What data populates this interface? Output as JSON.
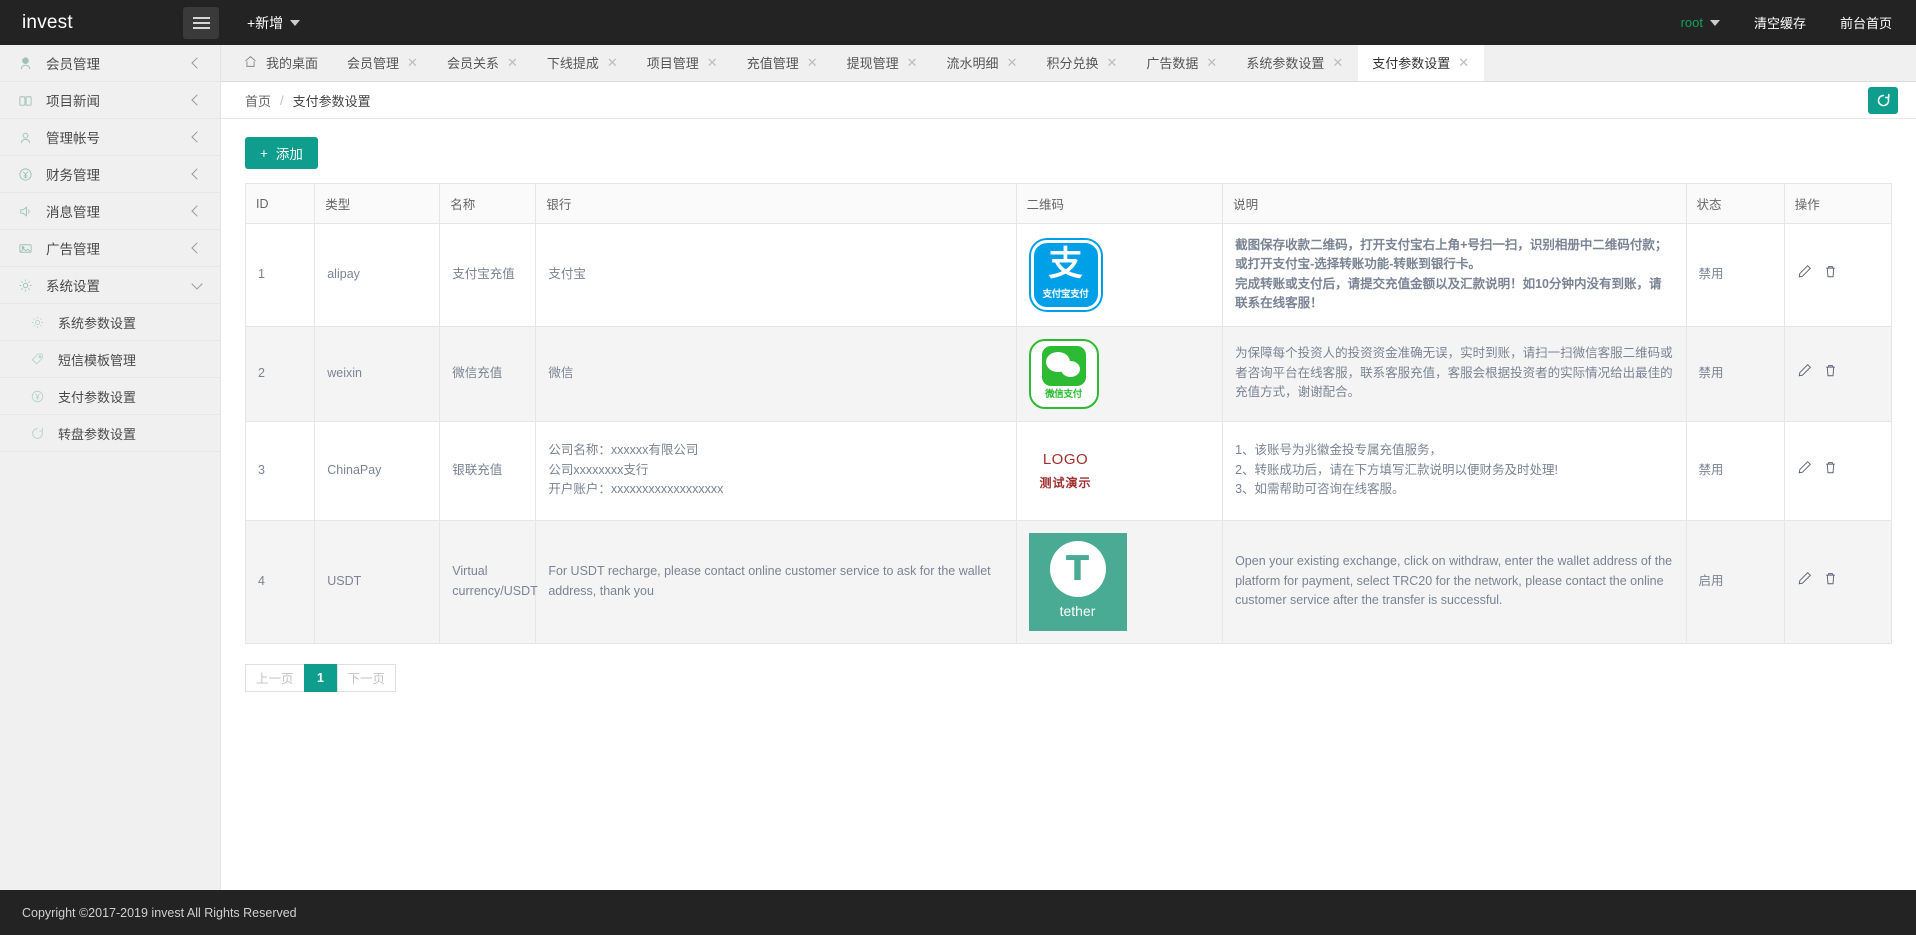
{
  "topbar": {
    "brand": "invest",
    "menu_toggle_icon": "hamburger-icon",
    "add_label": "+新增",
    "user": "root",
    "clear_cache": "清空缓存",
    "front_page": "前台首页"
  },
  "sidebar": {
    "items": [
      {
        "label": "会员管理",
        "icon": "user-icon",
        "state": "collapsed"
      },
      {
        "label": "项目新闻",
        "icon": "book-icon",
        "state": "collapsed"
      },
      {
        "label": "管理帐号",
        "icon": "user-circle-icon",
        "state": "collapsed"
      },
      {
        "label": "财务管理",
        "icon": "yuan-circle-icon",
        "state": "collapsed"
      },
      {
        "label": "消息管理",
        "icon": "speaker-icon",
        "state": "collapsed"
      },
      {
        "label": "广告管理",
        "icon": "image-icon",
        "state": "collapsed"
      },
      {
        "label": "系统设置",
        "icon": "gear-icon",
        "state": "expanded"
      }
    ],
    "sub_items": [
      {
        "label": "系统参数设置",
        "icon": "gear-small-icon"
      },
      {
        "label": "短信模板管理",
        "icon": "tag-icon"
      },
      {
        "label": "支付参数设置",
        "icon": "yuan-small-icon",
        "active": true
      },
      {
        "label": "转盘参数设置",
        "icon": "refresh-small-icon"
      }
    ]
  },
  "tabs": [
    {
      "label": "我的桌面",
      "icon": "home-icon",
      "closable": false
    },
    {
      "label": "会员管理",
      "closable": true
    },
    {
      "label": "会员关系",
      "closable": true
    },
    {
      "label": "下线提成",
      "closable": true
    },
    {
      "label": "项目管理",
      "closable": true
    },
    {
      "label": "充值管理",
      "closable": true
    },
    {
      "label": "提现管理",
      "closable": true
    },
    {
      "label": "流水明细",
      "closable": true
    },
    {
      "label": "积分兑换",
      "closable": true
    },
    {
      "label": "广告数据",
      "closable": true
    },
    {
      "label": "系统参数设置",
      "closable": true
    },
    {
      "label": "支付参数设置",
      "closable": true,
      "active": true
    }
  ],
  "breadcrumb": {
    "home": "首页",
    "separator": "/",
    "current": "支付参数设置"
  },
  "toolbar": {
    "add_label": "添加",
    "add_icon": "plus-icon",
    "refresh_icon": "refresh-icon"
  },
  "table": {
    "headers": [
      "ID",
      "类型",
      "名称",
      "银行",
      "二维码",
      "说明",
      "状态",
      "操作"
    ],
    "rows": [
      {
        "id": "1",
        "type": "alipay",
        "name": "支付宝充值",
        "bank": "支付宝",
        "qr": "alipay-logo",
        "qr_caption": "支付宝支付",
        "desc": "截图保存收款二维码，打开支付宝右上角+号扫一扫，识别相册中二维码付款；或打开支付宝-选择转账功能-转账到银行卡。\n完成转账或支付后，请提交充值金额以及汇款说明！如10分钟内没有到账，请联系在线客服！",
        "desc_color": "#fc1212",
        "status": "禁用",
        "actions": [
          "edit-icon",
          "delete-icon"
        ]
      },
      {
        "id": "2",
        "type": "weixin",
        "name": "微信充值",
        "bank": "微信",
        "qr": "wechat-logo",
        "qr_caption": "微信支付",
        "desc": "为保障每个投资人的投资资金准确无误，实时到账，请扫一扫微信客服二维码或者咨询平台在线客服，联系客服充值，客服会根据投资者的实际情况给出最佳的充值方式，谢谢配合。",
        "status": "禁用",
        "actions": [
          "edit-icon",
          "delete-icon"
        ]
      },
      {
        "id": "3",
        "type": "ChinaPay",
        "name": "银联充值",
        "bank": "公司名称：xxxxxx有限公司\n公司xxxxxxxx支行\n开户账户：xxxxxxxxxxxxxxxxxx",
        "qr": "placeholder-logo",
        "qr_line1": "LOGO",
        "qr_line2": "测试演示",
        "desc": "1、该账号为兆徽金投专属充值服务，\n2、转账成功后，请在下方填写汇款说明以便财务及时处理!\n3、如需帮助可咨询在线客服。",
        "status": "禁用",
        "actions": [
          "edit-icon",
          "delete-icon"
        ]
      },
      {
        "id": "4",
        "type": "USDT",
        "name": "Virtual currency/USDT",
        "bank": "For USDT recharge, please contact online customer service to ask for the wallet address, thank you",
        "qr": "tether-logo",
        "qr_caption": "tether",
        "desc": "Open your existing exchange, click on withdraw, enter the wallet address of the platform for payment, select TRC20 for the network, please contact the online customer service after the transfer is successful.",
        "status": "启用",
        "actions": [
          "edit-icon",
          "delete-icon"
        ]
      }
    ]
  },
  "pagination": {
    "prev": "上一页",
    "pages": [
      "1"
    ],
    "current": "1",
    "next": "下一页"
  },
  "footer": {
    "copyright": "Copyright ©2017-2019 invest All Rights Reserved"
  },
  "colors": {
    "accent": "#0f9e8e",
    "topbar_bg": "#232323",
    "sidebar_bg": "#f0f0f0",
    "danger_text": "#fc1212"
  }
}
